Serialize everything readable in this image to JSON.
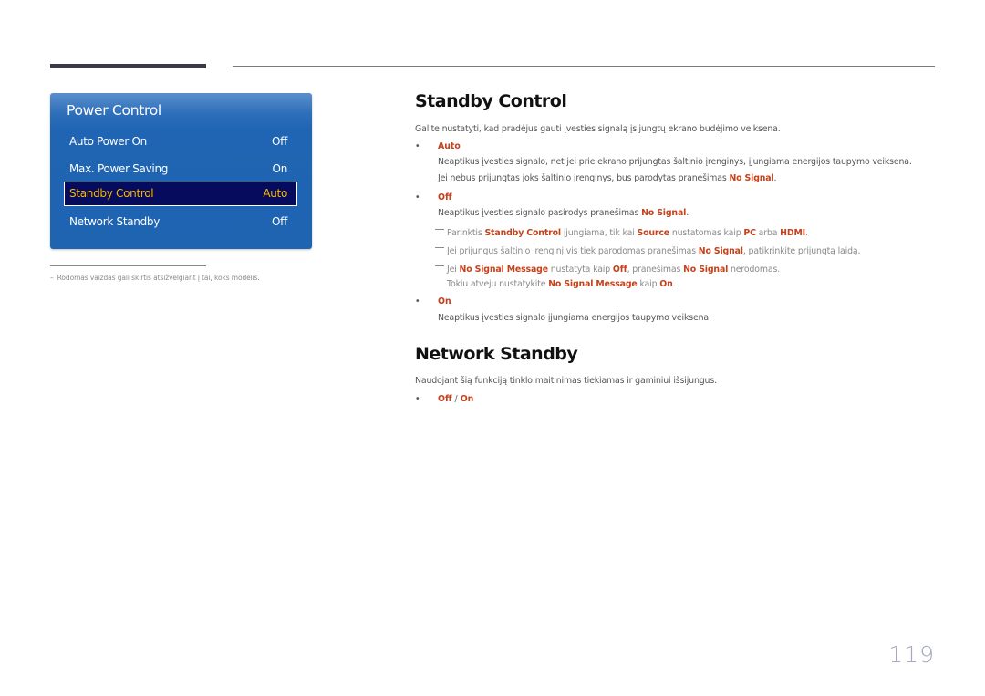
{
  "menu": {
    "title": "Power Control",
    "items": [
      {
        "label": "Auto Power On",
        "value": "Off",
        "selected": false
      },
      {
        "label": "Max. Power Saving",
        "value": "On",
        "selected": false
      },
      {
        "label": "Standby Control",
        "value": "Auto",
        "selected": true
      },
      {
        "label": "Network Standby",
        "value": "Off",
        "selected": false
      }
    ]
  },
  "footnote": {
    "dash": "–",
    "text": "Rodomas vaizdas gali skirtis atsižvelgiant į tai, koks modelis."
  },
  "standby": {
    "title": "Standby Control",
    "intro": "Galite nustatyti, kad pradėjus gauti įvesties signalą įsijungtų ekrano budėjimo veiksena.",
    "auto": {
      "label": "Auto",
      "line1": "Neaptikus įvesties signalo, net jei prie ekrano prijungtas šaltinio įrenginys, įjungiama energijos taupymo veiksena.",
      "line2_pre": "Jei nebus prijungtas joks šaltinio įrenginys, bus parodytas pranešimas ",
      "line2_hl": "No Signal",
      "line2_post": "."
    },
    "off": {
      "label": "Off",
      "line_pre": "Neaptikus įvesties signalo pasirodys pranešimas ",
      "line_hl": "No Signal",
      "line_post": "."
    },
    "notes": {
      "n1_a": "Parinktis ",
      "n1_b": "Standby Control",
      "n1_c": " įjungiama, tik kai ",
      "n1_d": "Source",
      "n1_e": " nustatomas kaip ",
      "n1_f": "PC",
      "n1_g": " arba ",
      "n1_h": "HDMI",
      "n1_i": ".",
      "n2_a": "Jei prijungus šaltinio įrenginį vis tiek parodomas pranešimas ",
      "n2_b": "No Signal",
      "n2_c": ", patikrinkite prijungtą laidą.",
      "n3_a": "Jei ",
      "n3_b": "No Signal Message",
      "n3_c": " nustatyta kaip ",
      "n3_d": "Off",
      "n3_e": ", pranešimas ",
      "n3_f": "No Signal",
      "n3_g": " nerodomas.",
      "n4_a": "Tokiu atveju nustatykite ",
      "n4_b": "No Signal Message",
      "n4_c": " kaip ",
      "n4_d": "On",
      "n4_e": "."
    },
    "on": {
      "label": "On",
      "line": "Neaptikus įvesties signalo įjungiama energijos taupymo veiksena."
    }
  },
  "network": {
    "title": "Network Standby",
    "intro": "Naudojant šią funkciją tinklo maitinimas tiekiamas ir gaminiui išsijungus.",
    "opt_off": "Off",
    "opt_sep": " / ",
    "opt_on": "On"
  },
  "bullet_char": "•",
  "page_number": "119"
}
